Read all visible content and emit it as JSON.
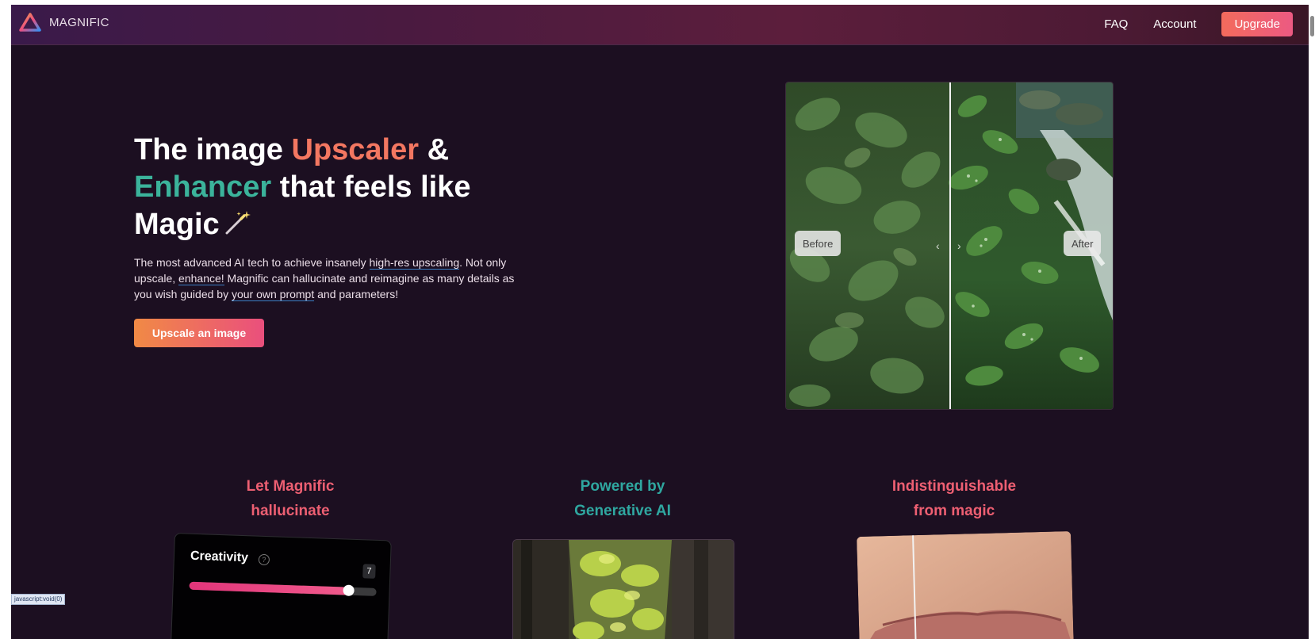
{
  "brand": {
    "name": "MAGNIFIC"
  },
  "nav": {
    "faq": "FAQ",
    "account": "Account",
    "upgrade": "Upgrade"
  },
  "hero": {
    "title_part1": "The image ",
    "title_upscaler": "Upscaler",
    "title_part2": " &",
    "title_enhancer": "Enhancer",
    "title_part3": " that feels like",
    "title_magic": "Magic",
    "desc_1": "The most advanced AI tech to achieve insanely ",
    "desc_link_1": "high-res upscaling",
    "desc_2": ". Not only upscale, ",
    "desc_link_2": "enhance!",
    "desc_3": " Magnific can hallucinate and reimagine as many details as you wish guided by ",
    "desc_link_3": "your own prompt",
    "desc_4": " and parameters!",
    "cta": "Upscale an image"
  },
  "compare": {
    "before": "Before",
    "after": "After",
    "divider_position": 0.5
  },
  "features": [
    {
      "line1": "Let Magnific",
      "line2": "hallucinate"
    },
    {
      "line1": "Powered by",
      "line2": "Generative AI"
    },
    {
      "line1": "Indistinguishable",
      "line2": "from magic"
    }
  ],
  "creativity": {
    "label": "Creativity",
    "help_icon": "question-circle-icon",
    "value": "7",
    "level": 0.85
  },
  "status_bar": {
    "text": "javascript:void(0)"
  },
  "colors": {
    "accent_orange": "#f37761",
    "accent_teal": "#3bb39b",
    "upgrade_gradient": [
      "#f36b5c",
      "#ec5a82"
    ],
    "background": "#1c0f21"
  }
}
